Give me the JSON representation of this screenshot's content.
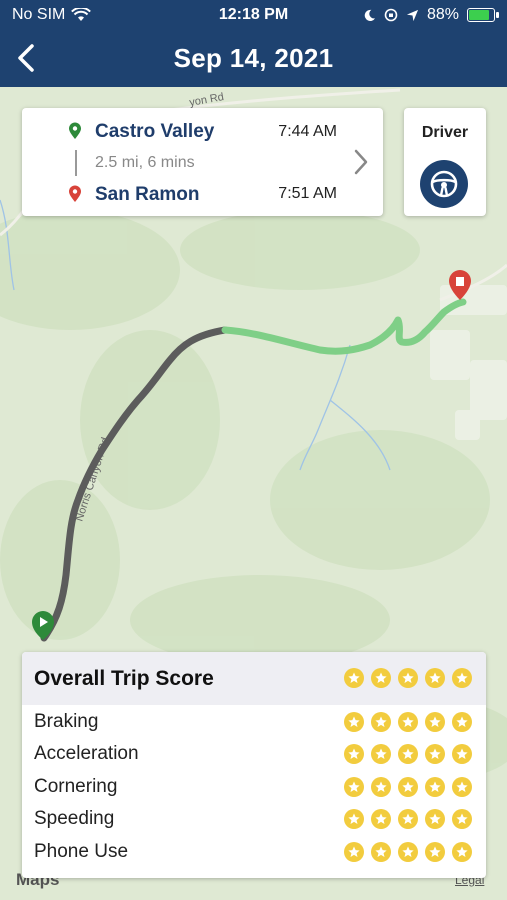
{
  "status_bar": {
    "carrier": "No SIM",
    "time": "12:18 PM",
    "battery": "88%",
    "battery_level": 0.88
  },
  "nav": {
    "title": "Sep 14, 2021"
  },
  "trip": {
    "from_name": "Castro Valley",
    "from_time": "7:44 AM",
    "summary": "2.5 mi, 6 mins",
    "to_name": "San Ramon",
    "to_time": "7:51 AM"
  },
  "driver": {
    "label": "Driver"
  },
  "map": {
    "road_label_1": "Norris Canyon Rd",
    "road_label_2": "yon Rd",
    "maps_label": "Maps",
    "legal": "Legal"
  },
  "score": {
    "title": "Overall Trip Score",
    "overall_stars": 5,
    "categories": [
      {
        "label": "Braking",
        "stars": 5
      },
      {
        "label": "Acceleration",
        "stars": 5
      },
      {
        "label": "Cornering",
        "stars": 5
      },
      {
        "label": "Speeding",
        "stars": 5
      },
      {
        "label": "Phone Use",
        "stars": 5
      }
    ]
  },
  "colors": {
    "nav": "#1e4270",
    "route_dark": "#5c5c5c",
    "route_green": "#7fcf87",
    "start_pin": "#2e8a3a",
    "end_pin": "#d8433a",
    "star": "#f2cc3e"
  }
}
